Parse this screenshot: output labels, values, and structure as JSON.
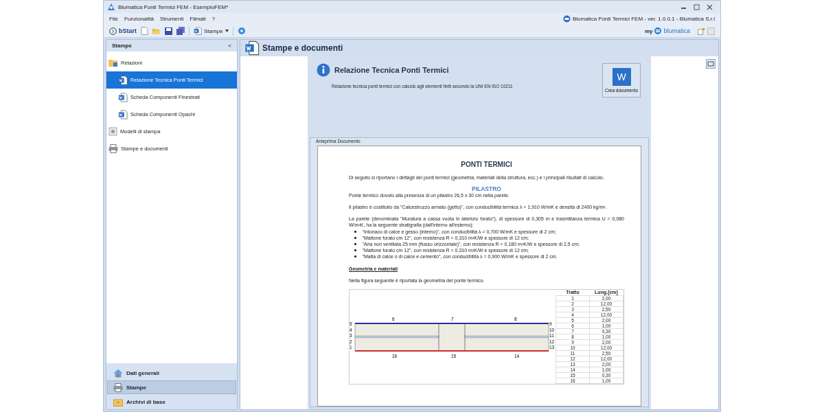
{
  "window": {
    "title": "Blumatica Ponti Termici FEM - EsempioFEM*"
  },
  "menu": [
    "File",
    "Funzionalità",
    "Strumenti",
    "Filmati",
    "?"
  ],
  "app_info": "Blumatica Ponti Termici FEM - ver. 1.0.0.1 - Blumatica S.r.l",
  "toolbar": {
    "start_label": "bStart",
    "print_label": "Stampe",
    "brand_prefix": "my",
    "brand_name": "blumatica"
  },
  "sidebar": {
    "title": "Stampe",
    "collapse": "<",
    "tree": [
      {
        "label": "Relazioni",
        "kind": "folder",
        "selected": false,
        "children": [
          {
            "label": "Relazione Tecnica Ponti Termici",
            "kind": "doc",
            "selected": true
          },
          {
            "label": "Scheda Componenti Finestrati",
            "kind": "doc",
            "selected": false
          },
          {
            "label": "Scheda Componenti Opachi",
            "kind": "doc",
            "selected": false
          }
        ]
      },
      {
        "label": "Modelli di stampa",
        "kind": "template",
        "selected": false
      },
      {
        "label": "Stampe e documenti",
        "kind": "printer",
        "selected": false
      }
    ],
    "nav": [
      {
        "label": "Dati generali",
        "kind": "home",
        "selected": false
      },
      {
        "label": "Stampe",
        "kind": "printer",
        "selected": true
      },
      {
        "label": "Archivi di base",
        "kind": "archive",
        "selected": false
      }
    ]
  },
  "main": {
    "title": "Stampe e documenti",
    "info": {
      "title": "Relazione Tecnica Ponti Termici",
      "description": "Relazione tecnica ponti termici con calcolo agli elementi finiti secondo la UNI EN ISO 10211"
    },
    "create_button": {
      "icon_text": "W",
      "label": "Crea documento"
    },
    "preview": {
      "title": "Anteprima Documento",
      "blocks": [
        {
          "kind": "title",
          "text": "PONTI TERMICI"
        },
        {
          "kind": "para",
          "text": "Di seguito si riportano i dettagli dei ponti termici (geometria, materiali della struttura, ecc.) e i principali risultati di calcolo."
        },
        {
          "kind": "subtitle",
          "text": "PILASTRO"
        },
        {
          "kind": "para",
          "text": "Ponte termico dovuto alla presenza di un pilastro 26,5 x 30 cm nella parete."
        },
        {
          "kind": "para",
          "text": "Il pilastro è costituito da \"Calcestruzzo armato (getto)\", con conducibilità termica λ = 1,910 W/mK e densità di 2400 kg/m³."
        },
        {
          "kind": "para",
          "text": "La parete (denominata \"Muratura a cassa vuota in laterizio forato\"), di spessore di 0,305 m e trasmittanza termica U = 0,980 W/m²K, ha la seguente stratigrafia (dall'interno all'esterno):"
        },
        {
          "kind": "bullets",
          "items": [
            "\"Intonaco di calce e gesso (interno)\", con conducibilità λ =  0,700 W/mK e spessore di 2 cm;",
            "\"Mattone forato cm 12\", con resistenza R =  0,310 m²K/W e spessore di 12 cm;",
            "\"Aria non ventilata 25 mm (flusso orizzontale)\", con resistenza R =  0,180 m²K/W e spessore di 2,5 cm;",
            "\"Mattone forato cm 12\", con resistenza R =  0,310 m²K/W e spessore di 12 cm;",
            "\"Malta di calce o di calce e cemento\", con conducibilità λ =  0,900 W/mK e spessore di 2 cm."
          ]
        },
        {
          "kind": "heading",
          "text": "Geometria e materiali"
        },
        {
          "kind": "para",
          "text": "Nella figura seguente è riportata la geometria del ponte termico."
        },
        {
          "kind": "figure",
          "top_labels": [
            "6",
            "7",
            "8"
          ],
          "left_labels": [
            "5",
            "4",
            "3",
            "2",
            "1"
          ],
          "right_labels": [
            "9",
            "10",
            "11",
            "12",
            "13"
          ],
          "bottom_labels": [
            "16",
            "15",
            "14"
          ],
          "columns": [
            "Tratto",
            "Lung.[cm]"
          ],
          "rows": [
            [
              "1",
              "2,00"
            ],
            [
              "2",
              "12,00"
            ],
            [
              "3",
              "2,50"
            ],
            [
              "4",
              "12,00"
            ],
            [
              "5",
              "2,00"
            ],
            [
              "6",
              "1,00"
            ],
            [
              "7",
              "0,30"
            ],
            [
              "8",
              "1,00"
            ],
            [
              "9",
              "2,00"
            ],
            [
              "10",
              "12,00"
            ],
            [
              "11",
              "2,50"
            ],
            [
              "12",
              "12,00"
            ],
            [
              "13",
              "2,00"
            ],
            [
              "14",
              "1,00"
            ],
            [
              "15",
              "0,30"
            ],
            [
              "16",
              "1,00"
            ]
          ]
        }
      ]
    }
  }
}
